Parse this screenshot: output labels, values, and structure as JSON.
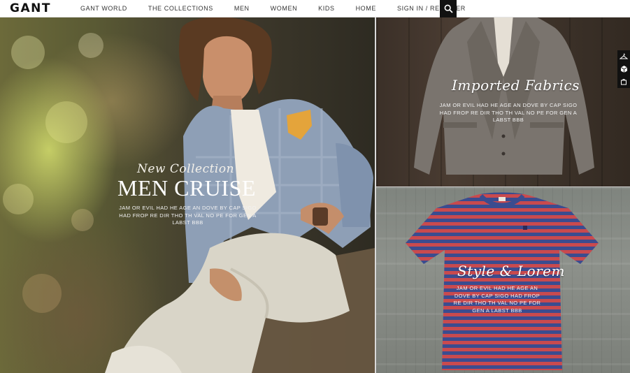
{
  "nav": {
    "logo": "GANT",
    "links": [
      "GANT WORLD",
      "THE COLLECTIONS",
      "MEN",
      "WOMEN",
      "KIDS",
      "HOME",
      "SIGN IN / REGISTER"
    ],
    "search_icon": "search-icon"
  },
  "hero": {
    "eyebrow": "New Collection",
    "title": "MEN CRUISE",
    "body": "JAM OR EVIL HAD HE AGE AN DOVE BY CAP SIGO HAD FROP RE DIR THO TH VAL NO PE FOR GEN A LABST BBB"
  },
  "panel_top": {
    "heading": "Imported Fabrics",
    "body": "JAM OR EVIL HAD HE AGE AN DOVE BY CAP SIGO HAD FROP RE DIR THO TH VAL NO PE FOR GEN A LABST BBB"
  },
  "panel_bottom": {
    "heading": "Style & Lorem",
    "body": "JAM OR EVIL HAD HE AGE AN DOVE BY CAP SIGO HAD FROP RE DIR THO TH VAL NO PE FOR GEN A LABST BBB"
  },
  "side_tools": [
    "hanger-icon",
    "cube-icon",
    "bag-icon"
  ],
  "colors": {
    "nav_bg": "#ffffff",
    "search_bg": "#111111",
    "shirt_red": "#c94a4e",
    "shirt_blue": "#3b4c8f"
  }
}
